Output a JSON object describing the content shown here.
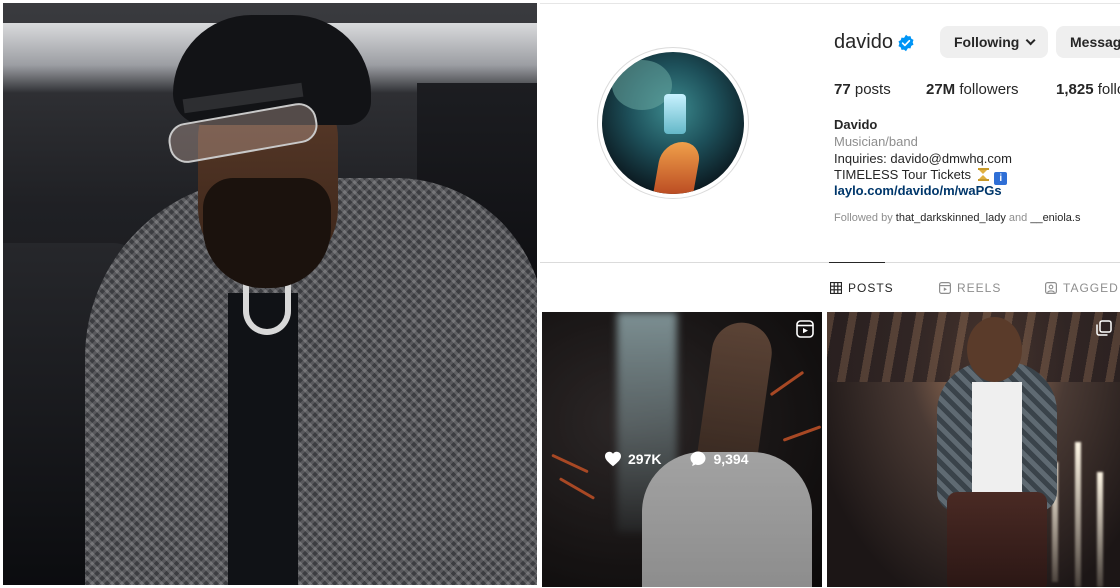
{
  "profile": {
    "username": "davido",
    "verified": true,
    "following_button": "Following",
    "message_button": "Messag",
    "stats": {
      "posts_count": "77",
      "posts_label": "posts",
      "followers_count": "27M",
      "followers_label": "followers",
      "following_count": "1,825",
      "following_label": "follo"
    },
    "bio": {
      "name": "Davido",
      "category": "Musician/band",
      "inquiries": "Inquiries: davido@dmwhq.com",
      "tour": "TIMELESS Tour Tickets",
      "link": "laylo.com/davido/m/waPGs"
    },
    "followed_by": {
      "prefix": "Followed by",
      "account1": "that_darkskinned_lady",
      "conj": "and",
      "account2": "__eniola.s"
    }
  },
  "tabs": [
    {
      "label": "POSTS",
      "active": true,
      "icon": "grid-icon"
    },
    {
      "label": "REELS",
      "active": false,
      "icon": "reels-icon"
    },
    {
      "label": "TAGGED",
      "active": false,
      "icon": "tagged-icon"
    }
  ],
  "posts": [
    {
      "type": "reel",
      "likes": "297K",
      "comments": "9,394",
      "icon": "reel-icon"
    },
    {
      "type": "carousel",
      "icon": "carousel-icon"
    }
  ],
  "colors": {
    "verified_blue": "#0095f6",
    "link_blue": "#00376b",
    "button_gray": "#efefef",
    "muted_text": "#8e8e8e"
  }
}
